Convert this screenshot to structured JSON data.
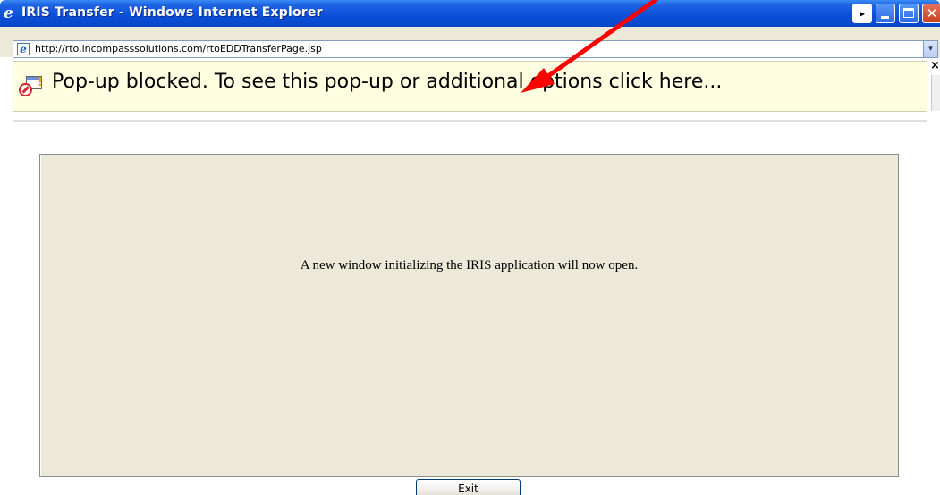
{
  "window": {
    "title": "IRIS Transfer - Windows Internet Explorer",
    "title_icon": "ie-logo-icon",
    "controls": [
      "arrow-icon",
      "minimize-icon",
      "maximize-icon",
      "close-icon"
    ]
  },
  "address": {
    "url": "http://rto.incompasssolutions.com/rtoEDDTransferPage.jsp",
    "page_icon": "ie-page-icon",
    "dropdown_glyph": "▾"
  },
  "infobar": {
    "message": "Pop-up blocked. To see this pop-up or additional options click here...",
    "icon": "popup-blocked-icon",
    "close_glyph": "×"
  },
  "content": {
    "message": "A new window initializing the IRIS application will now open.",
    "exit_label": "Exit"
  },
  "colors": {
    "titlebar": "#0a4fd8",
    "infobar": "#fffee1",
    "panel": "#ece9d8",
    "annotation_arrow": "#ff0000"
  }
}
